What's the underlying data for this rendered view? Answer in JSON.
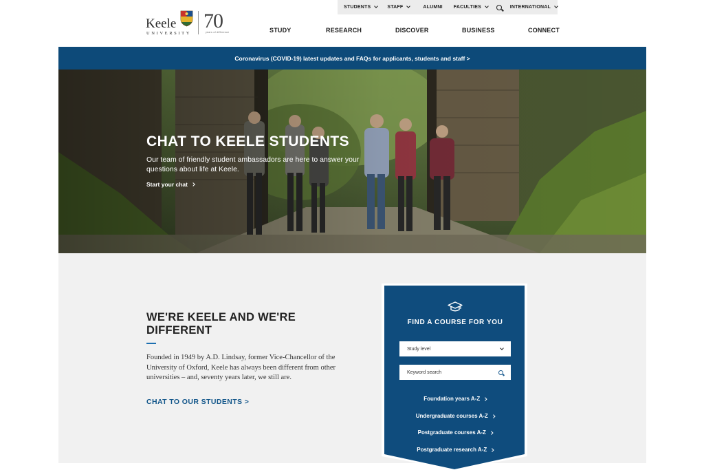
{
  "utility_nav": {
    "items": [
      {
        "label": "STUDENTS",
        "dropdown": true
      },
      {
        "label": "STAFF",
        "dropdown": true
      },
      {
        "label": "ALUMNI",
        "dropdown": false
      },
      {
        "label": "FACULTIES",
        "dropdown": true
      },
      {
        "label": "INTERNATIONAL",
        "dropdown": true
      }
    ],
    "search_icon": "search-icon"
  },
  "logo": {
    "wordmark": "Keele",
    "subtitle": "UNIVERSITY",
    "anniversary": "70",
    "anniversary_tagline": "years of difference"
  },
  "main_nav": {
    "items": [
      "STUDY",
      "RESEARCH",
      "DISCOVER",
      "BUSINESS",
      "CONNECT"
    ]
  },
  "covid_banner": {
    "text": "Coronavirus (COVID-19) latest updates and FAQs for applicants, students and staff >"
  },
  "hero": {
    "title": "CHAT TO KEELE STUDENTS",
    "description": "Our team of friendly student ambassadors are here to answer your questions about life at Keele.",
    "cta": "Start your chat"
  },
  "intro": {
    "heading": "WE'RE KEELE AND WE'RE DIFFERENT",
    "body": "Founded in 1949 by A.D. Lindsay, former Vice-Chancellor of the University of Oxford, Keele has always been different from other universities – and, seventy years later, we still are.",
    "cta": "CHAT TO OUR STUDENTS >"
  },
  "course_finder": {
    "icon": "graduation-cap-icon",
    "title": "FIND A COURSE FOR YOU",
    "study_level_placeholder": "Study level",
    "keyword_placeholder": "Keyword search",
    "links": [
      "Foundation years A-Z",
      "Undergraduate courses A-Z",
      "Postgraduate courses A-Z",
      "Postgraduate research A-Z"
    ]
  },
  "colors": {
    "brand_navy": "#0d4a79",
    "finder_blue": "#0f4c7d",
    "cta_blue": "#12568a",
    "accent_blue": "#1c6fb0",
    "section_bg": "#f1f1f1"
  }
}
